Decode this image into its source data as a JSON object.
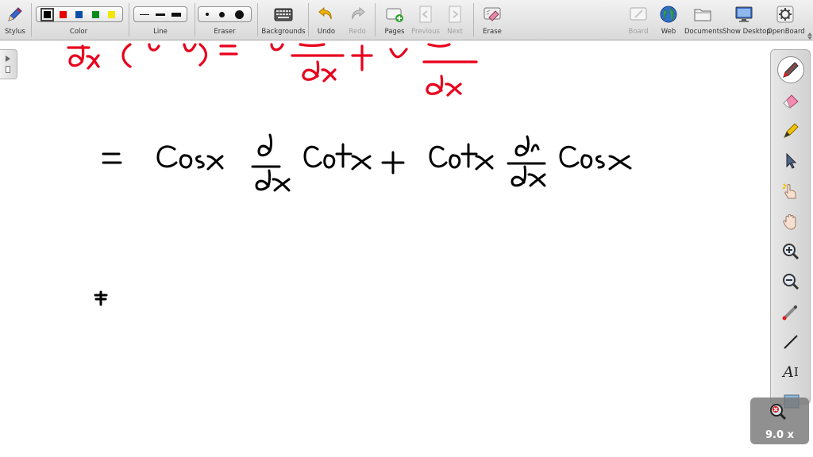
{
  "toolbar": {
    "stylus_label": "Stylus",
    "color_label": "Color",
    "line_label": "Line",
    "eraser_label": "Eraser",
    "backgrounds_label": "Backgrounds",
    "undo_label": "Undo",
    "redo_label": "Redo",
    "pages_label": "Pages",
    "previous_label": "Previous",
    "next_label": "Next",
    "erase_label": "Erase",
    "board_label": "Board",
    "web_label": "Web",
    "documents_label": "Documents",
    "show_desktop_label": "Show Desktop",
    "openboard_label": "OpenBoard"
  },
  "colors": {
    "swatches": [
      "#000000",
      "#e60000",
      "#0d4fa8",
      "#0a8a1a",
      "#f2e600"
    ],
    "selected": "#000000",
    "ink_red": "#e8001c",
    "ink_black": "#000000",
    "accent": "#f2c200"
  },
  "icons": {
    "stylus": "pen-icon",
    "backgrounds": "keyboard-grid-icon",
    "undo": "undo-arrow-icon",
    "redo": "redo-arrow-icon",
    "pages": "add-page-icon",
    "erase": "erase-board-icon",
    "web": "globe-icon",
    "documents": "folder-icon",
    "show_desktop": "monitor-icon",
    "openboard": "gear-icon"
  },
  "palette_tools": [
    "pen-icon",
    "eraser-icon",
    "marker-icon",
    "selector-arrow-icon",
    "interact-hand-icon",
    "grab-hand-icon",
    "zoom-in-icon",
    "zoom-out-icon",
    "laser-pointer-icon",
    "line-icon",
    "text-icon",
    "capture-icon"
  ],
  "palette_text_tool": "A",
  "zoom": {
    "level": "9.0 x"
  }
}
